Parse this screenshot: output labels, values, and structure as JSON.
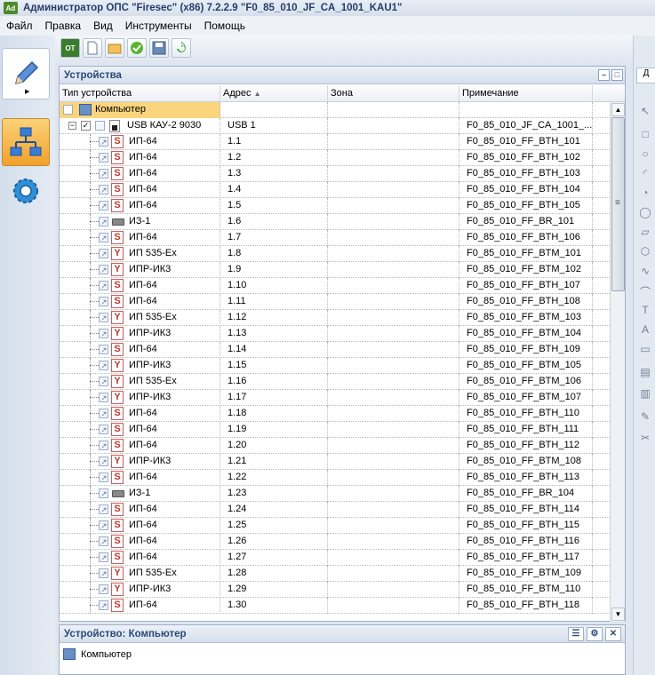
{
  "window": {
    "app_icon": "Ad",
    "title": "Администратор ОПС \"Firesec\"  (x86) 7.2.2.9   \"F0_85_010_JF_CA_1001_KAU1\""
  },
  "menu": [
    "Файл",
    "Правка",
    "Вид",
    "Инструменты",
    "Помощь"
  ],
  "toolbar": {
    "ot_label": "OT"
  },
  "devices_panel": {
    "title": "Устройства",
    "columns": [
      "Тип устройства",
      "Адрес",
      "Зона",
      "Примечание"
    ],
    "root": {
      "label": "Компьютер"
    },
    "kau": {
      "label": "USB КАУ-2 9030",
      "address": "USB 1",
      "note": "F0_85_010_JF_CA_1001_..."
    },
    "rows": [
      {
        "type": "ИП-64",
        "kind": "s",
        "address": "1.1",
        "note": "F0_85_010_FF_BTH_101"
      },
      {
        "type": "ИП-64",
        "kind": "s",
        "address": "1.2",
        "note": "F0_85_010_FF_BTH_102"
      },
      {
        "type": "ИП-64",
        "kind": "s",
        "address": "1.3",
        "note": "F0_85_010_FF_BTH_103"
      },
      {
        "type": "ИП-64",
        "kind": "s",
        "address": "1.4",
        "note": "F0_85_010_FF_BTH_104"
      },
      {
        "type": "ИП-64",
        "kind": "s",
        "address": "1.5",
        "note": "F0_85_010_FF_BTH_105"
      },
      {
        "type": "ИЗ-1",
        "kind": "iz",
        "address": "1.6",
        "note": "F0_85_010_FF_BR_101"
      },
      {
        "type": "ИП-64",
        "kind": "s",
        "address": "1.7",
        "note": "F0_85_010_FF_BTH_106"
      },
      {
        "type": "ИП 535-Ex",
        "kind": "y",
        "address": "1.8",
        "note": "F0_85_010_FF_BTM_101"
      },
      {
        "type": "ИПР-ИК3",
        "kind": "y",
        "address": "1.9",
        "note": "F0_85_010_FF_BTM_102"
      },
      {
        "type": "ИП-64",
        "kind": "s",
        "address": "1.10",
        "note": "F0_85_010_FF_BTH_107"
      },
      {
        "type": "ИП-64",
        "kind": "s",
        "address": "1.11",
        "note": "F0_85_010_FF_BTH_108"
      },
      {
        "type": "ИП 535-Ex",
        "kind": "y",
        "address": "1.12",
        "note": "F0_85_010_FF_BTM_103"
      },
      {
        "type": "ИПР-ИК3",
        "kind": "y",
        "address": "1.13",
        "note": "F0_85_010_FF_BTM_104"
      },
      {
        "type": "ИП-64",
        "kind": "s",
        "address": "1.14",
        "note": "F0_85_010_FF_BTH_109"
      },
      {
        "type": "ИПР-ИК3",
        "kind": "y",
        "address": "1.15",
        "note": "F0_85_010_FF_BTM_105"
      },
      {
        "type": "ИП 535-Ex",
        "kind": "y",
        "address": "1.16",
        "note": "F0_85_010_FF_BTM_106"
      },
      {
        "type": "ИПР-ИК3",
        "kind": "y",
        "address": "1.17",
        "note": "F0_85_010_FF_BTM_107"
      },
      {
        "type": "ИП-64",
        "kind": "s",
        "address": "1.18",
        "note": "F0_85_010_FF_BTH_110"
      },
      {
        "type": "ИП-64",
        "kind": "s",
        "address": "1.19",
        "note": "F0_85_010_FF_BTH_111"
      },
      {
        "type": "ИП-64",
        "kind": "s",
        "address": "1.20",
        "note": "F0_85_010_FF_BTH_112"
      },
      {
        "type": "ИПР-ИК3",
        "kind": "y",
        "address": "1.21",
        "note": "F0_85_010_FF_BTM_108"
      },
      {
        "type": "ИП-64",
        "kind": "s",
        "address": "1.22",
        "note": "F0_85_010_FF_BTH_113"
      },
      {
        "type": "ИЗ-1",
        "kind": "iz",
        "address": "1.23",
        "note": "F0_85_010_FF_BR_104"
      },
      {
        "type": "ИП-64",
        "kind": "s",
        "address": "1.24",
        "note": "F0_85_010_FF_BTH_114"
      },
      {
        "type": "ИП-64",
        "kind": "s",
        "address": "1.25",
        "note": "F0_85_010_FF_BTH_115"
      },
      {
        "type": "ИП-64",
        "kind": "s",
        "address": "1.26",
        "note": "F0_85_010_FF_BTH_116"
      },
      {
        "type": "ИП-64",
        "kind": "s",
        "address": "1.27",
        "note": "F0_85_010_FF_BTH_117"
      },
      {
        "type": "ИП 535-Ex",
        "kind": "y",
        "address": "1.28",
        "note": "F0_85_010_FF_BTM_109"
      },
      {
        "type": "ИПР-ИК3",
        "kind": "y",
        "address": "1.29",
        "note": "F0_85_010_FF_BTM_110"
      },
      {
        "type": "ИП-64",
        "kind": "s",
        "address": "1.30",
        "note": "F0_85_010_FF_BTH_118"
      }
    ]
  },
  "bottom_panel": {
    "title": "Устройство: Компьютер",
    "device_label": "Компьютер"
  },
  "right_panel": {
    "tab_label": "Д"
  }
}
